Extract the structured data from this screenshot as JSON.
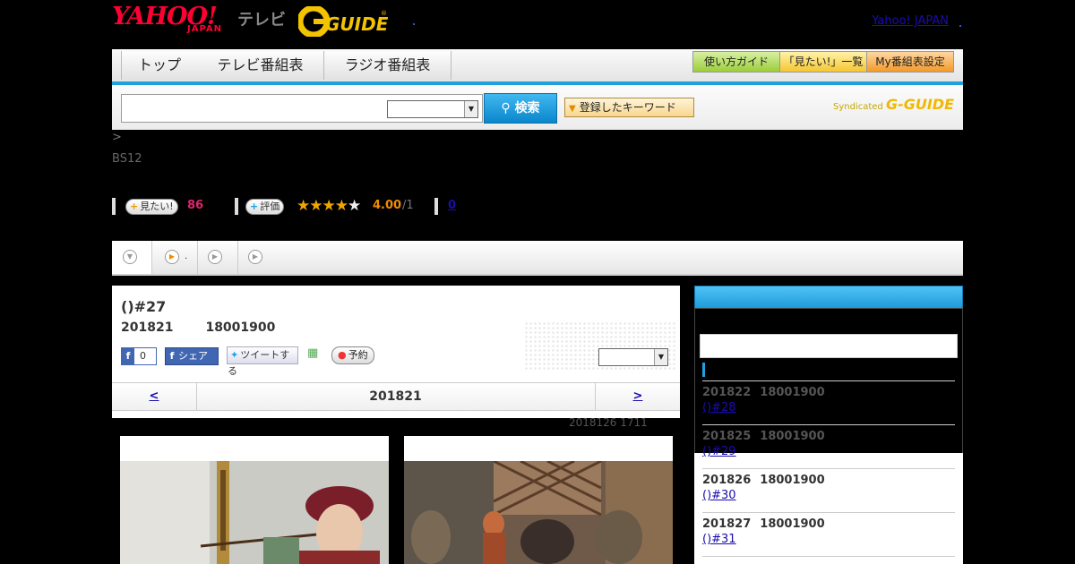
{
  "header": {
    "yahoo_logo": "YAHOO!",
    "japan_logo": "JAPAN",
    "tv_label": "テレビ",
    "gguide_logo": "G-GUIDE",
    "yahoo_japan_link": "Yahoo! JAPAN"
  },
  "nav": {
    "tabs": [
      {
        "label": "トップ"
      },
      {
        "label": "テレビ番組表"
      },
      {
        "label": "ラジオ番組表"
      }
    ],
    "buttons": {
      "guide": "使い方ガイド",
      "want_list": "「見たい!」一覧",
      "my_schedule": "My番組表設定"
    }
  },
  "search": {
    "input_value": "",
    "button_label": "検索",
    "keyword_button": "登録したキーワード",
    "syndicated": "Syndicated",
    "syndicated_logo": "G-GUIDE"
  },
  "breadcrumb": ">",
  "channel": "BS12",
  "ratings": {
    "want_button": "見たい!",
    "want_count": "86",
    "rate_button": "評価",
    "stars": 4,
    "score": "4.00",
    "score_total": "/1",
    "comments": "0"
  },
  "program": {
    "title": "()#27",
    "date": "201821",
    "time": "18001900",
    "fb_count": "0",
    "share_label": "シェア",
    "tweet_label": "ツイートする",
    "reserve_label": "予約",
    "nav": {
      "prev": "<",
      "current": "201821",
      "next": ">"
    },
    "updated": "2018126  1711"
  },
  "side": {
    "items": [
      {
        "date": "201822",
        "time": "18001900",
        "title": "()#28"
      },
      {
        "date": "201825",
        "time": "18001900",
        "title": "()#29"
      },
      {
        "date": "201826",
        "time": "18001900",
        "title": "()#30"
      },
      {
        "date": "201827",
        "time": "18001900",
        "title": "()#31"
      }
    ]
  },
  "colors": {
    "accent": "#1ea1dc",
    "yahoo_red": "#ff0033",
    "want_count": "#e0246e",
    "score": "#f08c00"
  }
}
